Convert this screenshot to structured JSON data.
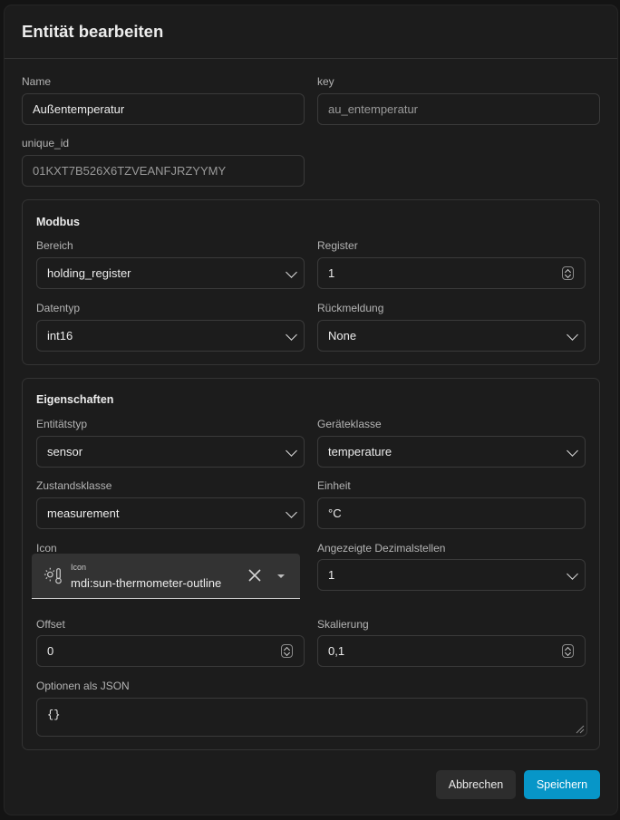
{
  "dialog": {
    "title": "Entität bearbeiten"
  },
  "fields": {
    "name": {
      "label": "Name",
      "value": "Außentemperatur"
    },
    "key": {
      "label": "key",
      "value": "au_entemperatur"
    },
    "unique_id": {
      "label": "unique_id",
      "value": "01KXT7B526X6TZVEANFJRZYYMY"
    }
  },
  "modbus": {
    "title": "Modbus",
    "bereich": {
      "label": "Bereich",
      "value": "holding_register"
    },
    "register": {
      "label": "Register",
      "value": "1"
    },
    "datentyp": {
      "label": "Datentyp",
      "value": "int16"
    },
    "rueckmeldung": {
      "label": "Rückmeldung",
      "value": "None"
    }
  },
  "eigenschaften": {
    "title": "Eigenschaften",
    "entitaetstyp": {
      "label": "Entitätstyp",
      "value": "sensor"
    },
    "geraeteklasse": {
      "label": "Geräteklasse",
      "value": "temperature"
    },
    "zustandsklasse": {
      "label": "Zustandsklasse",
      "value": "measurement"
    },
    "einheit": {
      "label": "Einheit",
      "value": "°C"
    },
    "icon": {
      "label": "Icon",
      "inner_label": "Icon",
      "value": "mdi:sun-thermometer-outline",
      "icon": "sun-thermometer-icon"
    },
    "dezimalstellen": {
      "label": "Angezeigte Dezimalstellen",
      "value": "1"
    },
    "offset": {
      "label": "Offset",
      "value": "0"
    },
    "skalierung": {
      "label": "Skalierung",
      "value": "0,1"
    },
    "optionen": {
      "label": "Optionen als JSON",
      "value": "{}"
    }
  },
  "actions": {
    "cancel_label": "Abbrechen",
    "save_label": "Speichern"
  },
  "colors": {
    "accent": "#0796c8",
    "background": "#1c1c1c",
    "border": "#3a3a3a"
  }
}
